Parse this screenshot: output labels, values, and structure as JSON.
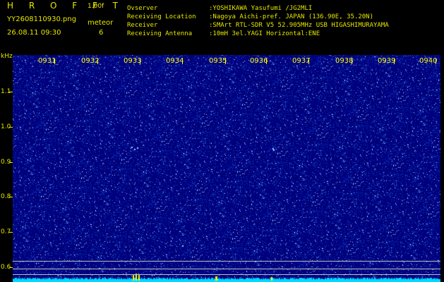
{
  "header": {
    "app_name": "H R O F F T",
    "version": "1.00f",
    "filename": "YY2608110930.png",
    "datetime": "26.08.11 09:30",
    "meteor_label": "meteor",
    "meteor_count": "6",
    "info": [
      {
        "key": "Ovserver",
        "value": ":YOSHIKAWA Yasufumi /JG2MLI"
      },
      {
        "key": "Receiving Location",
        "value": ":Nagoya Aichi-pref. JAPAN (136.90E, 35.20N)"
      },
      {
        "key": "Receiver",
        "value": ":SMArt RTL-SDR V5 52.905MHz USB HIGASHIMURAYAMA"
      },
      {
        "key": "Receiving Antenna",
        "value": ":10mH 3el.YAGI Horizontal:ENE"
      }
    ]
  },
  "axis": {
    "unit": "kHz",
    "y_ticks": [
      "1.1",
      "1.0",
      "0.9",
      "0.8",
      "0.7",
      "0.6"
    ],
    "y_values": [
      1.1,
      1.0,
      0.9,
      0.8,
      0.7,
      0.6
    ],
    "x_ticks": [
      "0931",
      "0932",
      "0933",
      "0934",
      "0935",
      "0936",
      "0937",
      "0938",
      "0939",
      "0940"
    ]
  },
  "colors": {
    "background": "#000000",
    "plot": "#00007a",
    "header_text": "#e6e600",
    "time_label": "#ffff00",
    "noise_floor": "#00d8ff",
    "meteor_marker": "#ffff00"
  }
}
